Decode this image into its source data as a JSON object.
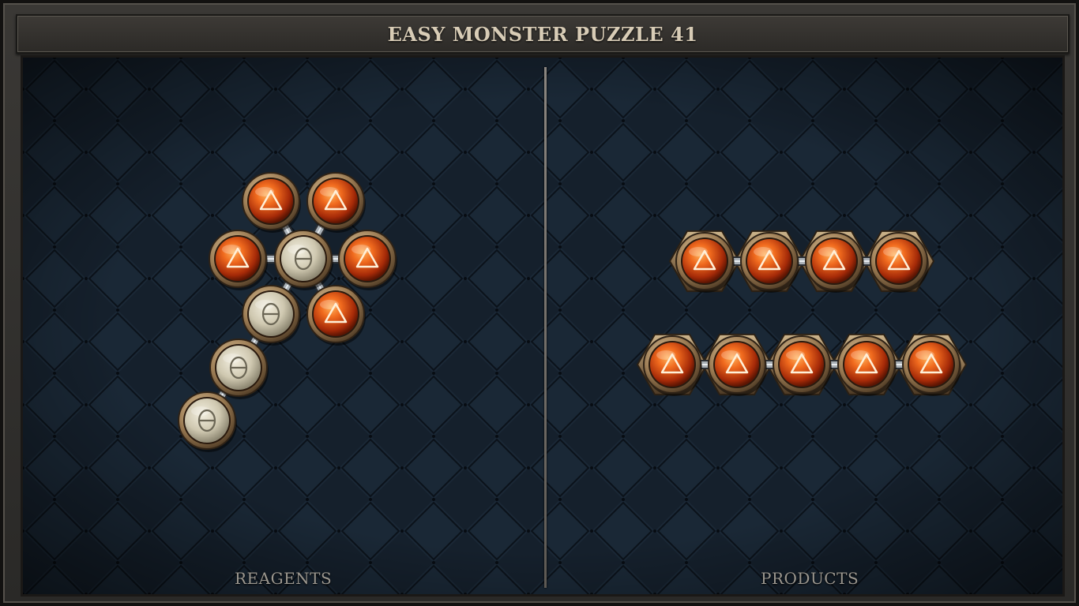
{
  "title": "EASY MONSTER PUZZLE 41",
  "panels": {
    "reagents_label": "REAGENTS",
    "products_label": "PRODUCTS"
  },
  "colors": {
    "fire_atom": "#e0551a",
    "neutral_atom": "#d8d2bd",
    "board": "#15202c",
    "frame_trim": "#8a5a33"
  },
  "icons": {
    "fire": "triangle",
    "neutral": "theta"
  },
  "reagents": {
    "molecule_count": 1,
    "atoms": [
      "fire",
      "fire",
      "fire",
      "neutral",
      "fire",
      "neutral",
      "fire",
      "neutral",
      "neutral"
    ],
    "bonds": 8
  },
  "products": {
    "molecules": [
      {
        "atoms": [
          "fire",
          "fire",
          "fire",
          "fire"
        ]
      },
      {
        "atoms": [
          "fire",
          "fire",
          "fire",
          "fire",
          "fire"
        ]
      }
    ]
  }
}
